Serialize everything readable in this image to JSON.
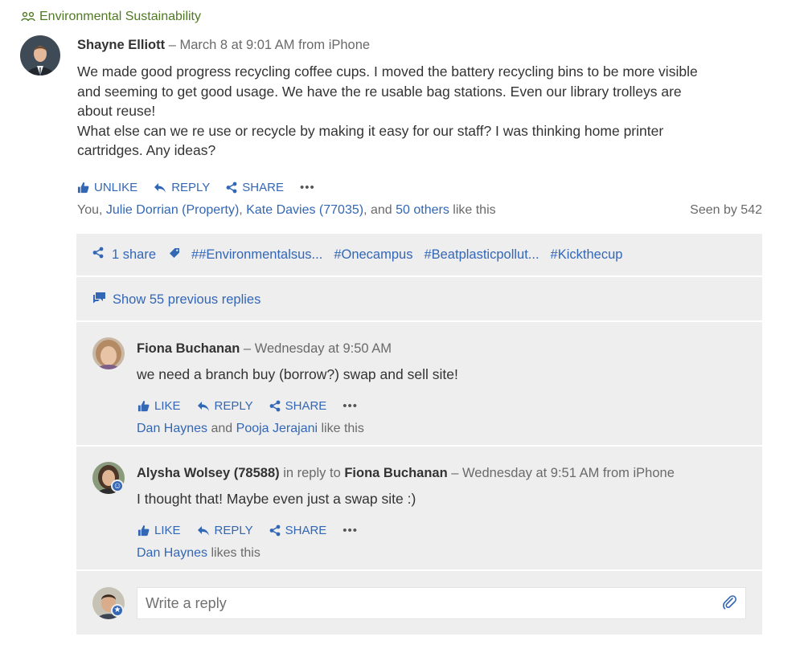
{
  "group": {
    "name": "Environmental Sustainability",
    "icon": "group-icon"
  },
  "post": {
    "author": "Shayne Elliott",
    "meta": " – March 8 at 9:01 AM from iPhone",
    "body_lines": [
      "We made good progress recycling coffee cups. I moved the battery recycling bins to be more visible",
      "and seeming to get good usage. We have the re usable bag stations. Even our library trolleys are",
      "about reuse!",
      "What else can we re use or recycle by making it easy for our staff? I was thinking home printer",
      "cartridges. Any ideas?"
    ],
    "actions": {
      "like": "UNLIKE",
      "reply": "REPLY",
      "share": "SHARE",
      "more": "•••"
    },
    "likes": {
      "you": "You,",
      "person1": "Julie Dorrian (Property)",
      "comma": ",",
      "person2": "Kate Davies (77035)",
      "and": ", and",
      "others": "50 others",
      "suffix": "like this"
    },
    "seen": "Seen by 542"
  },
  "thread": {
    "shares": "1 share",
    "tags": [
      "##Environmentalsus...",
      "#Onecampus",
      "#Beatplasticpollut...",
      "#Kickthecup"
    ],
    "show_previous": "Show 55 previous replies",
    "replies": [
      {
        "author": "Fiona Buchanan",
        "meta": " – Wednesday at 9:50 AM",
        "body": "we need a branch buy (borrow?) swap and sell site!",
        "actions": {
          "like": "LIKE",
          "reply": "REPLY",
          "share": "SHARE",
          "more": "•••"
        },
        "likes": {
          "p1": "Dan Haynes",
          "and": " and ",
          "p2": "Pooja Jerajani",
          "suffix": " like this"
        }
      },
      {
        "author": "Alysha Wolsey (78588)",
        "in_reply": " in reply to ",
        "reply_to": "Fiona Buchanan",
        "meta": " – Wednesday at 9:51 AM from iPhone",
        "body": "I thought that! Maybe even just a swap site :)",
        "actions": {
          "like": "LIKE",
          "reply": "REPLY",
          "share": "SHARE",
          "more": "•••"
        },
        "likes": {
          "p1": "Dan Haynes",
          "suffix": " likes this"
        }
      }
    ],
    "compose": {
      "placeholder": "Write a reply",
      "attach_icon": "paperclip-icon"
    }
  },
  "colors": {
    "link": "#3367b6",
    "group": "#4f7a21",
    "thread_bg": "#eeeeee",
    "text": "#333333",
    "meta": "#6a6a6a"
  }
}
